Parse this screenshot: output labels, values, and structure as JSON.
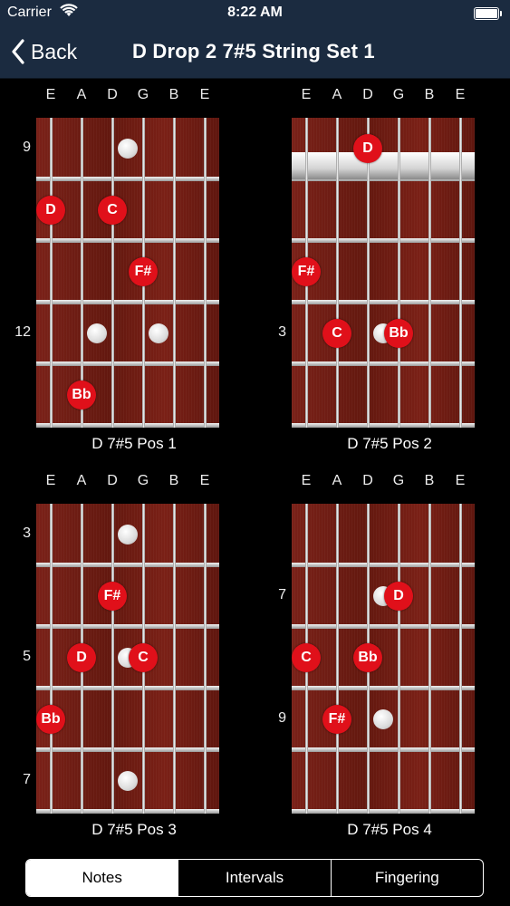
{
  "status": {
    "carrier": "Carrier",
    "time": "8:22 AM"
  },
  "nav": {
    "back": "Back",
    "title": "D Drop 2 7#5 String Set 1"
  },
  "strings": [
    "E",
    "A",
    "D",
    "G",
    "B",
    "E"
  ],
  "diagrams": [
    {
      "caption": "D 7#5 Pos 1",
      "nut": false,
      "fret_labels": [
        {
          "row": 1,
          "text": "9"
        },
        {
          "row": 4,
          "text": "12"
        }
      ],
      "inlays": [
        {
          "row": 1,
          "string": 3.5
        },
        {
          "row": 4,
          "string": 2.5
        },
        {
          "row": 4,
          "string": 4.5
        }
      ],
      "notes": [
        {
          "row": 2,
          "string": 1,
          "label": "D"
        },
        {
          "row": 2,
          "string": 3,
          "label": "C"
        },
        {
          "row": 3,
          "string": 4,
          "label": "F#"
        },
        {
          "row": 5,
          "string": 2,
          "label": "Bb"
        }
      ]
    },
    {
      "caption": "D 7#5 Pos 2",
      "nut": true,
      "fret_labels": [
        {
          "row": 4,
          "text": "3"
        }
      ],
      "inlays": [
        {
          "row": 4,
          "string": 3.5
        }
      ],
      "notes": [
        {
          "row": 1,
          "string": 3,
          "label": "D"
        },
        {
          "row": 3,
          "string": 1,
          "label": "F#"
        },
        {
          "row": 4,
          "string": 2,
          "label": "C"
        },
        {
          "row": 4,
          "string": 4,
          "label": "Bb"
        }
      ]
    },
    {
      "caption": "D 7#5 Pos 3",
      "nut": false,
      "fret_labels": [
        {
          "row": 1,
          "text": "3"
        },
        {
          "row": 3,
          "text": "5"
        },
        {
          "row": 5,
          "text": "7"
        }
      ],
      "inlays": [
        {
          "row": 1,
          "string": 3.5
        },
        {
          "row": 3,
          "string": 3.5
        },
        {
          "row": 5,
          "string": 3.5
        }
      ],
      "notes": [
        {
          "row": 2,
          "string": 3,
          "label": "F#"
        },
        {
          "row": 3,
          "string": 2,
          "label": "D"
        },
        {
          "row": 3,
          "string": 4,
          "label": "C"
        },
        {
          "row": 4,
          "string": 1,
          "label": "Bb"
        }
      ]
    },
    {
      "caption": "D 7#5 Pos 4",
      "nut": false,
      "fret_labels": [
        {
          "row": 2,
          "text": "7"
        },
        {
          "row": 4,
          "text": "9"
        }
      ],
      "inlays": [
        {
          "row": 2,
          "string": 3.5
        },
        {
          "row": 4,
          "string": 3.5
        }
      ],
      "notes": [
        {
          "row": 2,
          "string": 4,
          "label": "D"
        },
        {
          "row": 3,
          "string": 1,
          "label": "C"
        },
        {
          "row": 3,
          "string": 3,
          "label": "Bb"
        },
        {
          "row": 4,
          "string": 2,
          "label": "F#"
        }
      ]
    }
  ],
  "tabs": [
    {
      "label": "Notes",
      "active": true
    },
    {
      "label": "Intervals",
      "active": false
    },
    {
      "label": "Fingering",
      "active": false
    }
  ],
  "colors": {
    "navbar": "#1b2b40",
    "note": "#e0101a",
    "fretboard": "#6e1d14"
  }
}
